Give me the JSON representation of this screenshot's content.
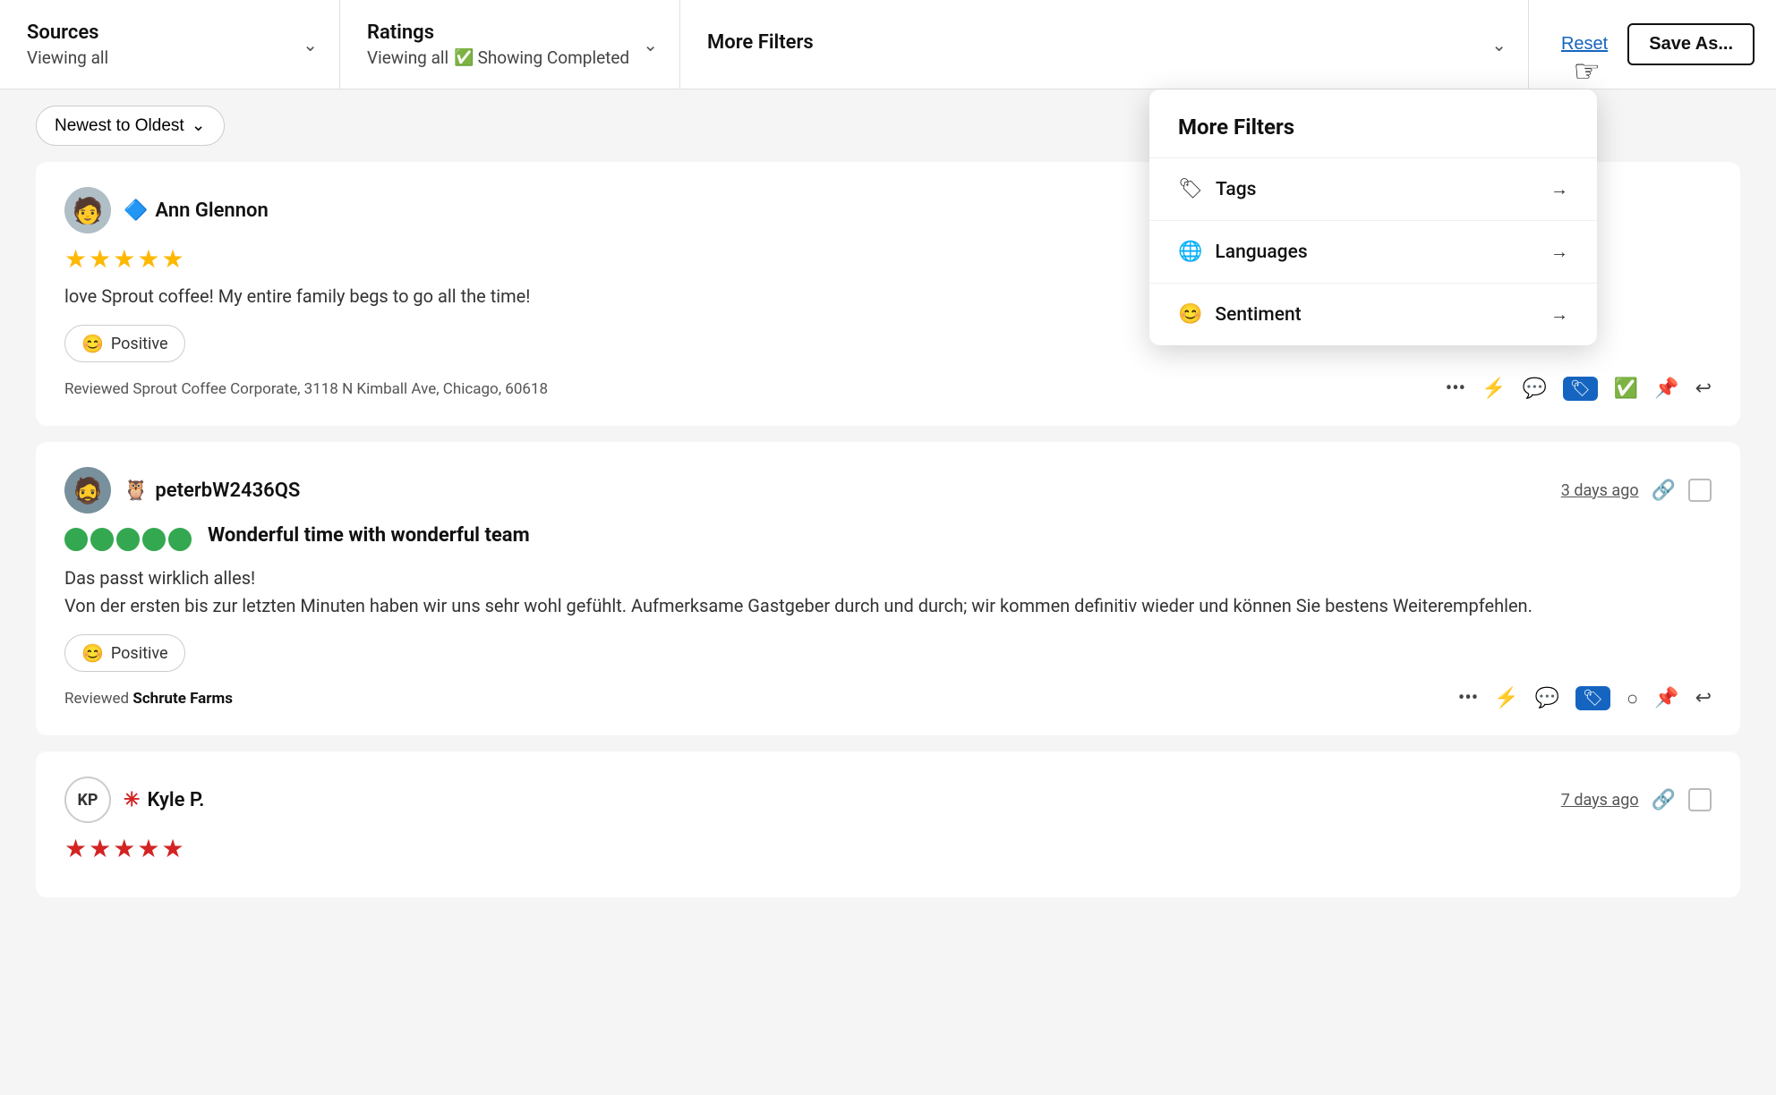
{
  "filterBar": {
    "sources": {
      "label": "Sources",
      "sub": "Viewing all"
    },
    "ratings": {
      "label": "Ratings",
      "sub": "Viewing all",
      "subExtra": "Showing Completed"
    },
    "moreFilters": {
      "label": "More Filters"
    },
    "resetLabel": "Reset",
    "saveAsLabel": "Save As..."
  },
  "sortBar": {
    "sortLabel": "Newest to Oldest"
  },
  "dropdownPanel": {
    "title": "More Filters",
    "items": [
      {
        "icon": "🏷",
        "label": "Tags"
      },
      {
        "icon": "🌐",
        "label": "Languages"
      },
      {
        "icon": "😊",
        "label": "Sentiment"
      }
    ]
  },
  "reviews": [
    {
      "id": "ann",
      "avatarText": "👤",
      "avatarType": "ann",
      "platformIcon": "🔷",
      "userName": "Ann Glennon",
      "starCount": 5,
      "reviewText": "love Sprout coffee! My entire family begs to go all the time!",
      "sentiment": "Positive",
      "location": "Reviewed Sprout Coffee Corporate, 3118 N Kimball Ave, Chicago, 60618",
      "timeAgo": null
    },
    {
      "id": "peter",
      "avatarText": "👤",
      "avatarType": "peter",
      "platformIcon": "TA",
      "userName": "peterbW2436QS",
      "timeAgo": "3 days ago",
      "reviewTitle": "Wonderful time with wonderful team",
      "reviewText": "Das passt wirklich alles!\nVon der ersten bis zur letzten Minuten haben wir uns sehr wohl gefühlt. Aufmerksame Gastgeber durch und durch; wir kommen definitiv wieder und können Sie bestens Weiterempfehlen.",
      "sentiment": "Positive",
      "location": "Reviewed",
      "locationBold": "Schrute Farms",
      "starCount": 5
    },
    {
      "id": "kyle",
      "avatarText": "KP",
      "avatarType": "kyle",
      "platformIcon": "yelp",
      "userName": "Kyle P.",
      "timeAgo": "7 days ago",
      "starCount": 5
    }
  ]
}
